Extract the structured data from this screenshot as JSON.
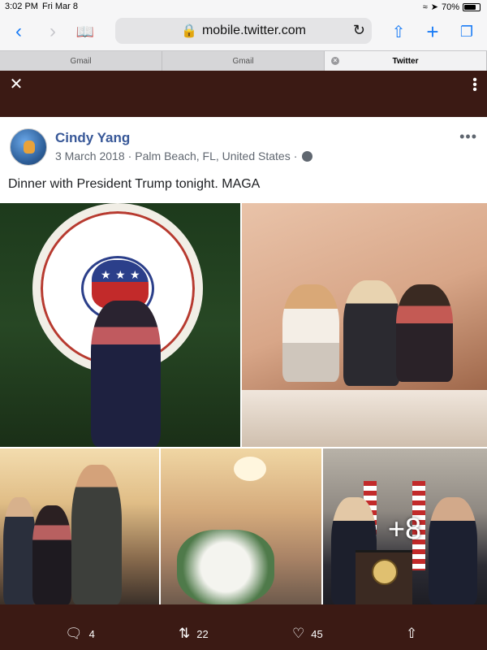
{
  "status_bar": {
    "time": "3:02 PM",
    "date": "Fri Mar 8",
    "battery": "70%",
    "battery_level": 0.7
  },
  "browser": {
    "url": "mobile.twitter.com",
    "tabs": [
      {
        "label": "Gmail",
        "active": false
      },
      {
        "label": "Gmail",
        "active": false
      },
      {
        "label": "Twitter",
        "active": true
      }
    ]
  },
  "post": {
    "author": "Cindy Yang",
    "date": "3 March 2018",
    "separator": "·",
    "location": "Palm Beach, FL, United States",
    "text": "Dinner with President Trump tonight. MAGA",
    "more_photos": "+8"
  },
  "actions": {
    "replies": "4",
    "retweets": "22",
    "likes": "45"
  },
  "colors": {
    "background": "#3b1a14",
    "link_blue": "#385898",
    "safari_blue": "#1a7cf6"
  }
}
